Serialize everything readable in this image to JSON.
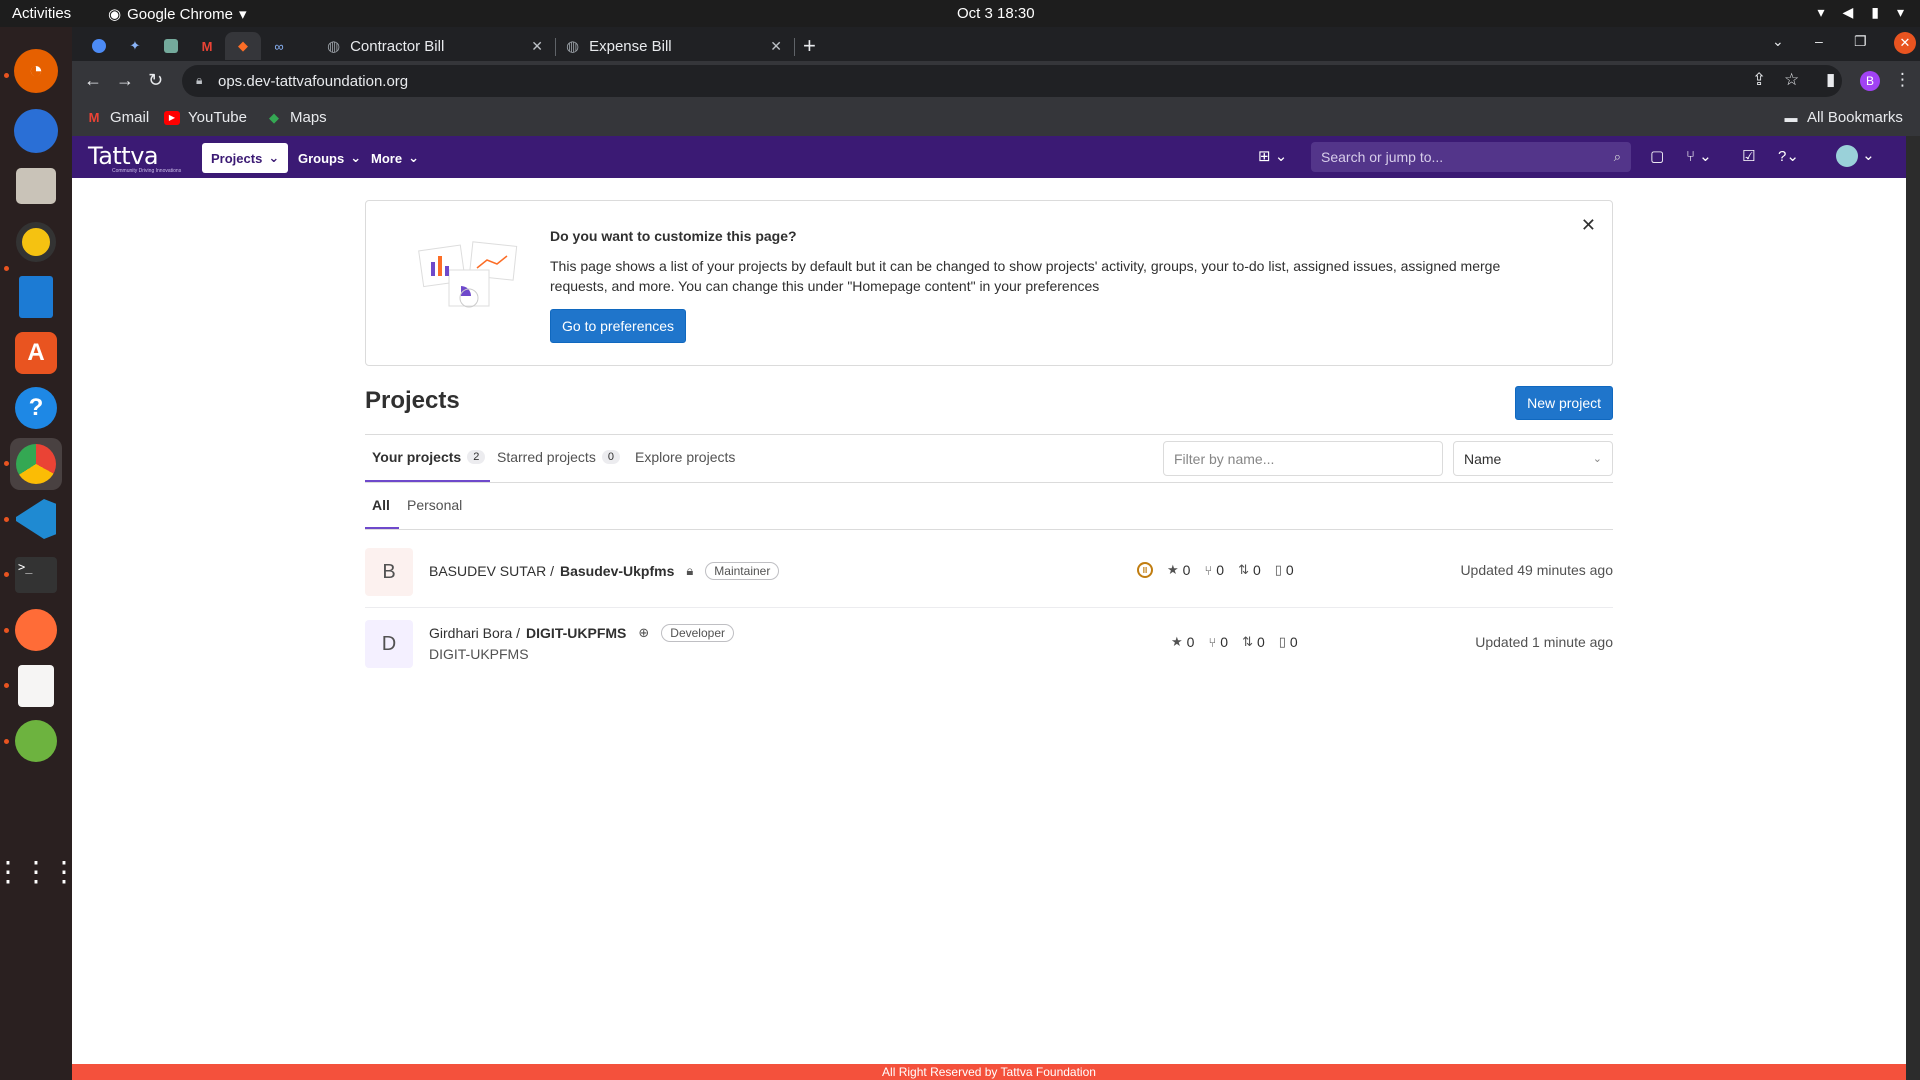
{
  "os": {
    "activities": "Activities",
    "app_name": "Google Chrome",
    "clock": "Oct 3  18:30"
  },
  "browser": {
    "tabs": [
      {
        "title": "Contractor Bill"
      },
      {
        "title": "Expense Bill"
      }
    ],
    "url": "ops.dev-tattvafoundation.org",
    "profile_initial": "B",
    "bookmarks": [
      "Gmail",
      "YouTube",
      "Maps"
    ],
    "all_bookmarks": "All Bookmarks"
  },
  "gitlab": {
    "logo": "Tattva",
    "logo_sub": "Community Driving Innovations",
    "nav": {
      "projects": "Projects",
      "groups": "Groups",
      "more": "More"
    },
    "search_placeholder": "Search or jump to..."
  },
  "banner": {
    "title": "Do you want to customize this page?",
    "text": "This page shows a list of your projects by default but it can be changed to show projects' activity, groups, your to-do list, assigned issues, assigned merge requests, and more. You can change this under \"Homepage content\" in your preferences",
    "button": "Go to preferences"
  },
  "page": {
    "title": "Projects",
    "new_project": "New project",
    "tabs": [
      {
        "label": "Your projects",
        "count": "2"
      },
      {
        "label": "Starred projects",
        "count": "0"
      },
      {
        "label": "Explore projects"
      }
    ],
    "filter_placeholder": "Filter by name...",
    "sort": "Name",
    "subtabs": [
      "All",
      "Personal"
    ]
  },
  "projects": [
    {
      "avatar": "B",
      "namespace": "BASUDEV SUTAR / ",
      "name": "Basudev-Ukpfms",
      "role": "Maintainer",
      "description": "",
      "stars": "0",
      "forks": "0",
      "mrs": "0",
      "issues": "0",
      "updated": "Updated 49 minutes ago"
    },
    {
      "avatar": "D",
      "namespace": "Girdhari Bora / ",
      "name": "DIGIT-UKPFMS",
      "role": "Developer",
      "description": "DIGIT-UKPFMS",
      "stars": "0",
      "forks": "0",
      "mrs": "0",
      "issues": "0",
      "updated": "Updated 1 minute ago"
    }
  ],
  "footer": "All Right Reserved by Tattva Foundation",
  "colors": {
    "header": "#3b1a74",
    "primary_button": "#1f75cb",
    "footer": "#f4513c",
    "tab_underline": "#6e49cb"
  }
}
